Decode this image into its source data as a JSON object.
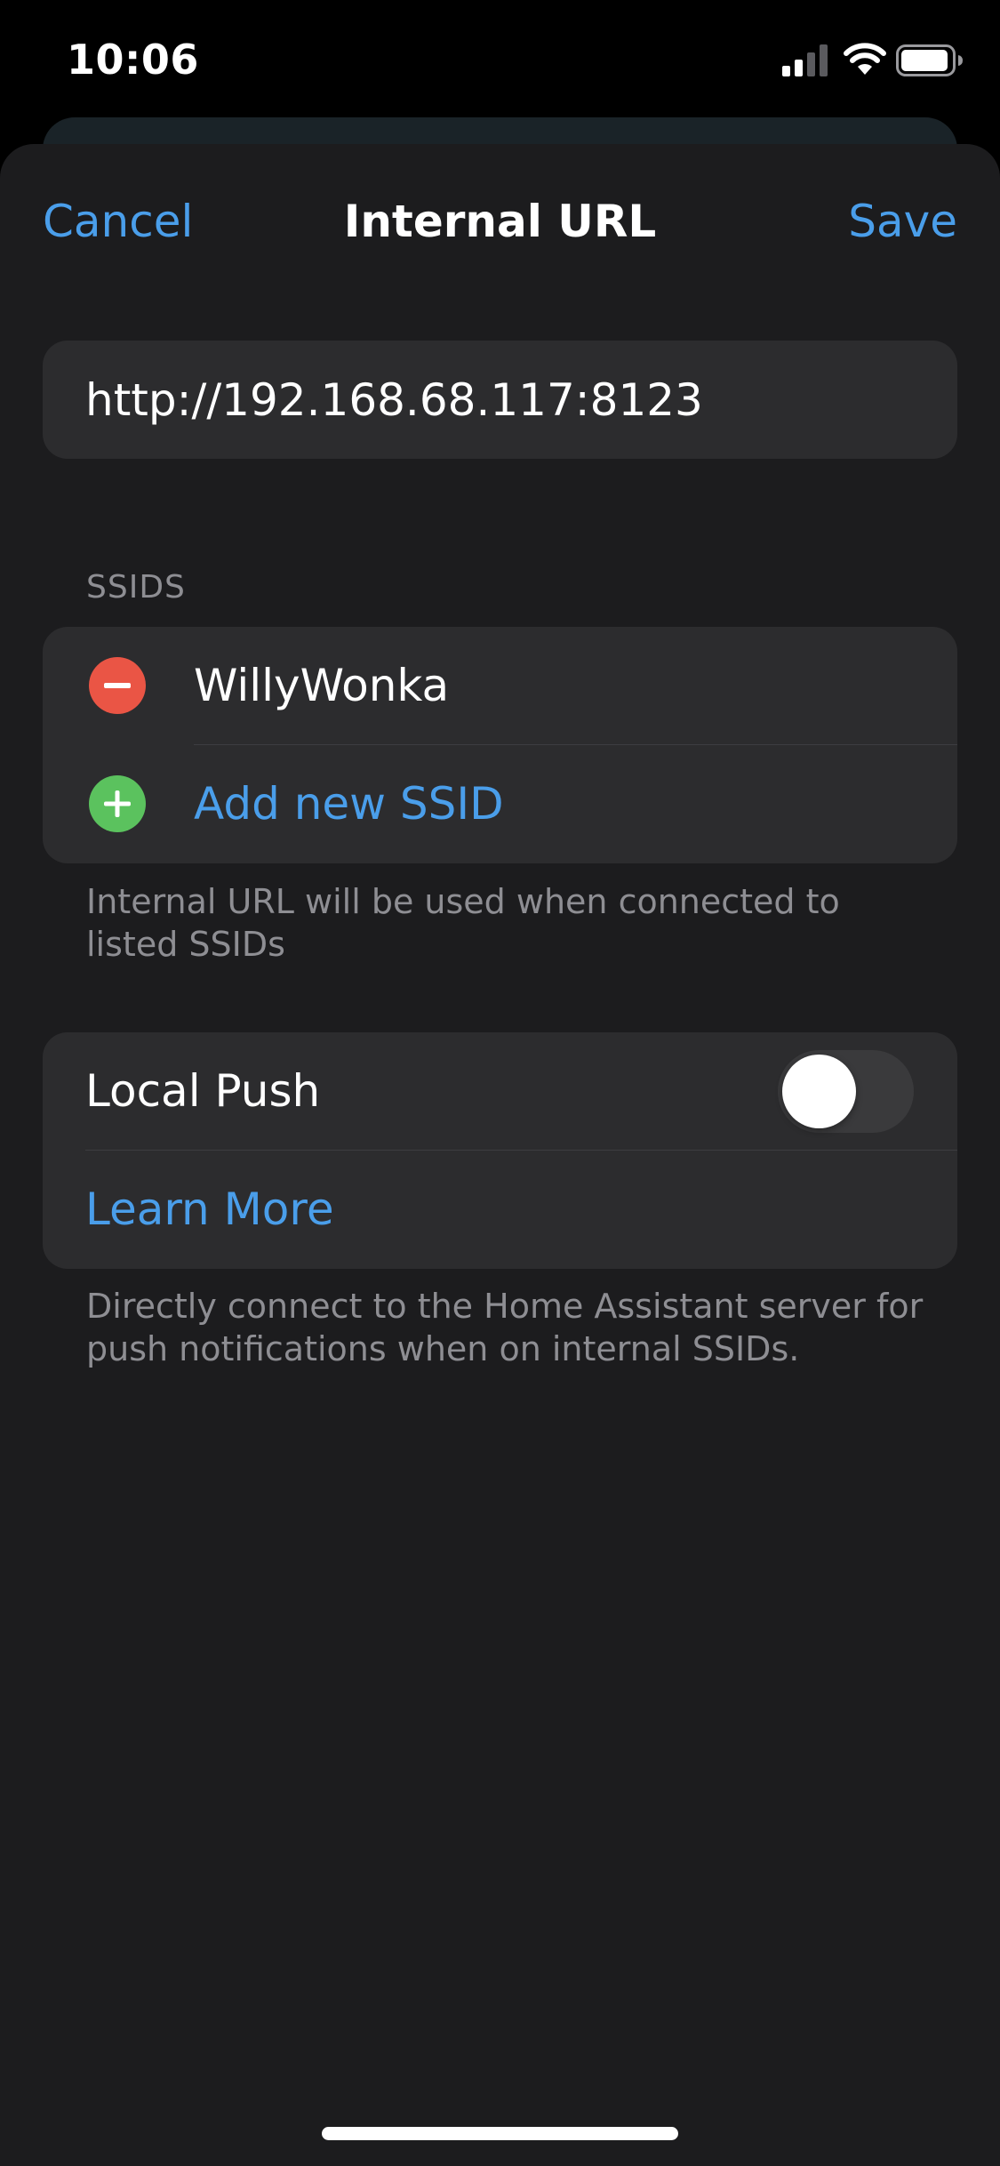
{
  "status_bar": {
    "time": "10:06",
    "signal_icon": "cellular-signal-icon",
    "wifi_icon": "wifi-icon",
    "battery_icon": "battery-icon"
  },
  "nav": {
    "cancel_label": "Cancel",
    "title": "Internal URL",
    "save_label": "Save"
  },
  "url_field": {
    "value": "http://192.168.68.117:8123"
  },
  "ssids": {
    "header": "SSIDS",
    "items": [
      {
        "name": "WillyWonka",
        "action_icon": "minus-circle-icon"
      }
    ],
    "add_label": "Add new SSID",
    "add_icon": "plus-circle-icon",
    "footer": "Internal URL will be used when connected to listed SSIDs"
  },
  "local_push": {
    "label": "Local Push",
    "enabled": false,
    "learn_more_label": "Learn More",
    "footer": "Directly connect to the Home Assistant server for push notifications when on internal SSIDs."
  },
  "colors": {
    "accent": "#4a9eea",
    "remove": "#ea5545",
    "add": "#5bc25e",
    "sheet_background": "#1c1c1e",
    "cell_background": "#2c2c2e"
  }
}
